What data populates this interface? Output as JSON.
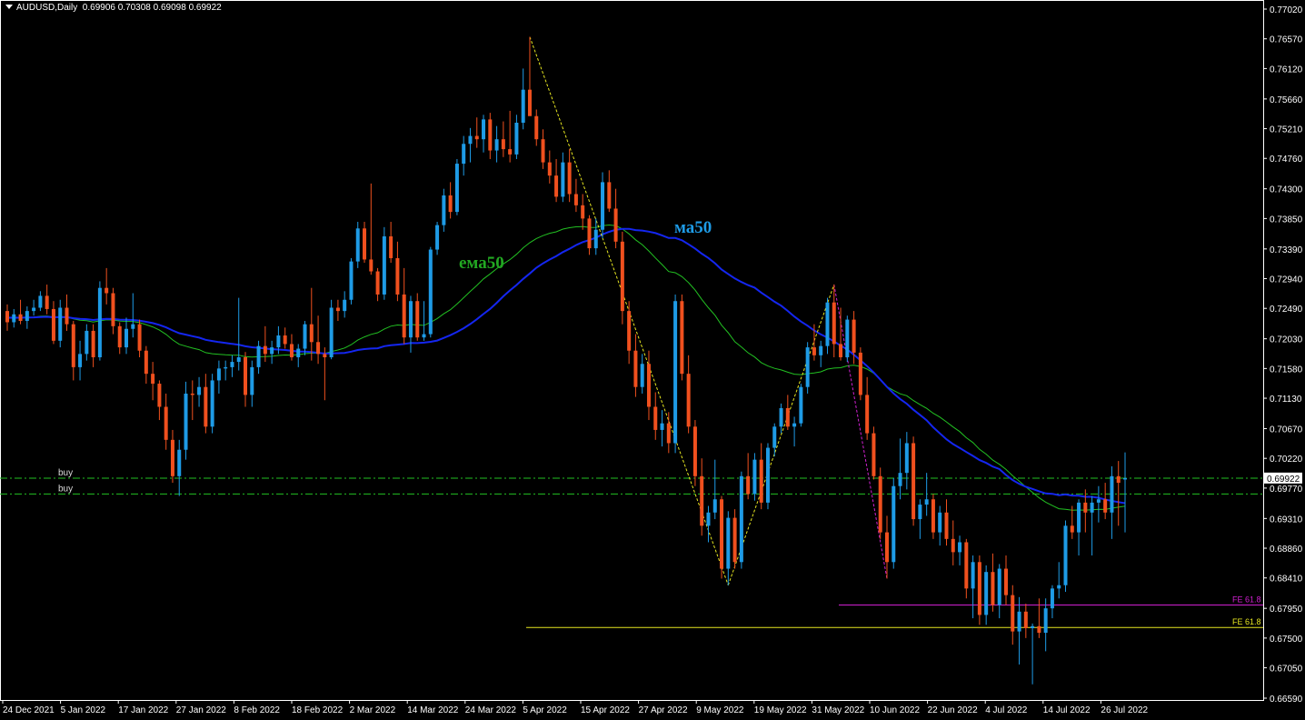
{
  "header": {
    "symbol": "AUDUSD,Daily",
    "ohlc": "0.69906 0.70308 0.69098 0.69922"
  },
  "colors": {
    "background": "#000000",
    "bull": "#1e9be6",
    "bear": "#f0501e",
    "ma50": "#1426f0",
    "ema50": "#22c022",
    "price_tag_bg": "#ffffff",
    "buy_line": "#22c022",
    "fe_magenta": "#d020d0",
    "fe_yellow": "#e6e620",
    "zigzag_yellow": "#e6e620",
    "zigzag_magenta": "#d020d0"
  },
  "chart_data": {
    "type": "candlestick",
    "ylim": [
      0.6659,
      0.7702
    ],
    "y_ticks": [
      "0.77020",
      "0.76570",
      "0.76120",
      "0.75660",
      "0.75210",
      "0.74760",
      "0.74300",
      "0.73850",
      "0.73390",
      "0.72940",
      "0.72490",
      "0.72030",
      "0.71580",
      "0.71130",
      "0.70670",
      "0.70220",
      "0.69770",
      "0.69310",
      "0.68860",
      "0.68410",
      "0.67950",
      "0.67500",
      "0.67050",
      "0.66590"
    ],
    "x_labels": [
      "24 Dec 2021",
      "5 Jan 2022",
      "17 Jan 2022",
      "27 Jan 2022",
      "8 Feb 2022",
      "18 Feb 2022",
      "2 Mar 2022",
      "14 Mar 2022",
      "24 Mar 2022",
      "5 Apr 2022",
      "15 Apr 2022",
      "27 Apr 2022",
      "9 May 2022",
      "19 May 2022",
      "31 May 2022",
      "10 Jun 2022",
      "22 Jun 2022",
      "4 Jul 2022",
      "14 Jul 2022",
      "26 Jul 2022"
    ],
    "current_price": "0.69922",
    "ohlc": [
      [
        0.7245,
        0.7255,
        0.7215,
        0.7228
      ],
      [
        0.7228,
        0.7248,
        0.722,
        0.724
      ],
      [
        0.724,
        0.7262,
        0.7225,
        0.723
      ],
      [
        0.723,
        0.7252,
        0.7218,
        0.7245
      ],
      [
        0.7245,
        0.7262,
        0.7238,
        0.725
      ],
      [
        0.725,
        0.7275,
        0.7245,
        0.7268
      ],
      [
        0.7268,
        0.7285,
        0.724,
        0.7248
      ],
      [
        0.7248,
        0.726,
        0.7195,
        0.72
      ],
      [
        0.72,
        0.7262,
        0.719,
        0.725
      ],
      [
        0.725,
        0.727,
        0.7215,
        0.7225
      ],
      [
        0.7225,
        0.723,
        0.714,
        0.716
      ],
      [
        0.716,
        0.72,
        0.714,
        0.718
      ],
      [
        0.718,
        0.7225,
        0.717,
        0.7215
      ],
      [
        0.7215,
        0.7225,
        0.716,
        0.7175
      ],
      [
        0.7175,
        0.729,
        0.717,
        0.728
      ],
      [
        0.728,
        0.731,
        0.7255,
        0.7272
      ],
      [
        0.7272,
        0.728,
        0.721,
        0.7222
      ],
      [
        0.7222,
        0.7228,
        0.718,
        0.719
      ],
      [
        0.719,
        0.7235,
        0.718,
        0.7218
      ],
      [
        0.7218,
        0.7272,
        0.7205,
        0.7225
      ],
      [
        0.7225,
        0.7232,
        0.7175,
        0.7185
      ],
      [
        0.7185,
        0.7192,
        0.7135,
        0.715
      ],
      [
        0.715,
        0.7168,
        0.711,
        0.7135
      ],
      [
        0.7135,
        0.714,
        0.708,
        0.71
      ],
      [
        0.71,
        0.712,
        0.7035,
        0.705
      ],
      [
        0.705,
        0.7065,
        0.6985,
        0.6995
      ],
      [
        0.6995,
        0.705,
        0.6965,
        0.7035
      ],
      [
        0.7035,
        0.7138,
        0.702,
        0.712
      ],
      [
        0.712,
        0.714,
        0.708,
        0.7118
      ],
      [
        0.7118,
        0.7145,
        0.71,
        0.713
      ],
      [
        0.713,
        0.715,
        0.706,
        0.707
      ],
      [
        0.707,
        0.715,
        0.706,
        0.714
      ],
      [
        0.714,
        0.717,
        0.712,
        0.7158
      ],
      [
        0.7158,
        0.717,
        0.714,
        0.716
      ],
      [
        0.716,
        0.7178,
        0.7145,
        0.7168
      ],
      [
        0.7168,
        0.7265,
        0.7155,
        0.7175
      ],
      [
        0.7175,
        0.7183,
        0.71,
        0.7118
      ],
      [
        0.7118,
        0.717,
        0.71,
        0.716
      ],
      [
        0.716,
        0.72,
        0.715,
        0.7192
      ],
      [
        0.7192,
        0.7222,
        0.7168,
        0.718
      ],
      [
        0.718,
        0.72,
        0.7165,
        0.719
      ],
      [
        0.719,
        0.7222,
        0.718,
        0.7208
      ],
      [
        0.7208,
        0.722,
        0.7188,
        0.7195
      ],
      [
        0.7195,
        0.721,
        0.717,
        0.7175
      ],
      [
        0.7175,
        0.7195,
        0.716,
        0.7188
      ],
      [
        0.7188,
        0.723,
        0.7178,
        0.7225
      ],
      [
        0.7225,
        0.728,
        0.717,
        0.7198
      ],
      [
        0.7198,
        0.7238,
        0.7165,
        0.718
      ],
      [
        0.718,
        0.719,
        0.711,
        0.7175
      ],
      [
        0.7175,
        0.7262,
        0.7172,
        0.725
      ],
      [
        0.725,
        0.7262,
        0.723,
        0.7245
      ],
      [
        0.7245,
        0.7275,
        0.7235,
        0.7262
      ],
      [
        0.7262,
        0.7325,
        0.7255,
        0.732
      ],
      [
        0.732,
        0.738,
        0.731,
        0.737
      ],
      [
        0.737,
        0.738,
        0.7318,
        0.7323
      ],
      [
        0.7323,
        0.7438,
        0.73,
        0.7305
      ],
      [
        0.7305,
        0.731,
        0.726,
        0.727
      ],
      [
        0.727,
        0.7372,
        0.7262,
        0.7358
      ],
      [
        0.7358,
        0.738,
        0.7318,
        0.7325
      ],
      [
        0.7325,
        0.735,
        0.726,
        0.727
      ],
      [
        0.727,
        0.731,
        0.7195,
        0.7205
      ],
      [
        0.7205,
        0.7268,
        0.7182,
        0.726
      ],
      [
        0.726,
        0.7272,
        0.72,
        0.7205
      ],
      [
        0.7205,
        0.726,
        0.72,
        0.721
      ],
      [
        0.721,
        0.7342,
        0.7205,
        0.7338
      ],
      [
        0.7338,
        0.738,
        0.733,
        0.7375
      ],
      [
        0.7375,
        0.743,
        0.7365,
        0.742
      ],
      [
        0.742,
        0.744,
        0.7385,
        0.7395
      ],
      [
        0.7395,
        0.7475,
        0.739,
        0.7468
      ],
      [
        0.7468,
        0.751,
        0.745,
        0.7498
      ],
      [
        0.7498,
        0.7522,
        0.747,
        0.751
      ],
      [
        0.751,
        0.7538,
        0.7492,
        0.7505
      ],
      [
        0.7505,
        0.7542,
        0.7485,
        0.7535
      ],
      [
        0.7535,
        0.7545,
        0.7475,
        0.7488
      ],
      [
        0.7488,
        0.7525,
        0.747,
        0.7505
      ],
      [
        0.7505,
        0.7532,
        0.7478,
        0.749
      ],
      [
        0.749,
        0.7548,
        0.747,
        0.7482
      ],
      [
        0.7482,
        0.7542,
        0.7475,
        0.753
      ],
      [
        0.753,
        0.7612,
        0.752,
        0.758
      ],
      [
        0.758,
        0.766,
        0.755,
        0.754
      ],
      [
        0.754,
        0.755,
        0.7495,
        0.7505
      ],
      [
        0.7505,
        0.752,
        0.746,
        0.747
      ],
      [
        0.747,
        0.7488,
        0.7438,
        0.745
      ],
      [
        0.745,
        0.7475,
        0.741,
        0.7418
      ],
      [
        0.7418,
        0.7485,
        0.741,
        0.747
      ],
      [
        0.747,
        0.749,
        0.741,
        0.7422
      ],
      [
        0.7422,
        0.7445,
        0.7395,
        0.7405
      ],
      [
        0.7405,
        0.7422,
        0.7368,
        0.7385
      ],
      [
        0.7385,
        0.739,
        0.733,
        0.734
      ],
      [
        0.734,
        0.7385,
        0.733,
        0.7368
      ],
      [
        0.7368,
        0.7455,
        0.7355,
        0.744
      ],
      [
        0.744,
        0.7458,
        0.7395,
        0.74
      ],
      [
        0.74,
        0.743,
        0.734,
        0.735
      ],
      [
        0.735,
        0.7365,
        0.7225,
        0.7245
      ],
      [
        0.7245,
        0.726,
        0.7165,
        0.7185
      ],
      [
        0.7185,
        0.721,
        0.7115,
        0.713
      ],
      [
        0.713,
        0.718,
        0.712,
        0.7165
      ],
      [
        0.7165,
        0.7185,
        0.708,
        0.71
      ],
      [
        0.71,
        0.7122,
        0.705,
        0.7065
      ],
      [
        0.7065,
        0.7095,
        0.704,
        0.7075
      ],
      [
        0.7075,
        0.7092,
        0.703,
        0.7045
      ],
      [
        0.7045,
        0.727,
        0.703,
        0.726
      ],
      [
        0.726,
        0.727,
        0.714,
        0.715
      ],
      [
        0.715,
        0.7178,
        0.706,
        0.707
      ],
      [
        0.707,
        0.708,
        0.698,
        0.6995
      ],
      [
        0.6995,
        0.7022,
        0.6905,
        0.692
      ],
      [
        0.692,
        0.695,
        0.6895,
        0.694
      ],
      [
        0.694,
        0.702,
        0.693,
        0.696
      ],
      [
        0.696,
        0.6965,
        0.684,
        0.6855
      ],
      [
        0.6855,
        0.6942,
        0.683,
        0.6932
      ],
      [
        0.6932,
        0.6945,
        0.6855,
        0.6865
      ],
      [
        0.6865,
        0.7002,
        0.6855,
        0.6995
      ],
      [
        0.6995,
        0.703,
        0.696,
        0.6968
      ],
      [
        0.6968,
        0.703,
        0.6958,
        0.702
      ],
      [
        0.702,
        0.7045,
        0.6945,
        0.6955
      ],
      [
        0.6955,
        0.7045,
        0.6945,
        0.7038
      ],
      [
        0.7038,
        0.7075,
        0.7025,
        0.707
      ],
      [
        0.707,
        0.7105,
        0.706,
        0.7098
      ],
      [
        0.7098,
        0.7118,
        0.7065,
        0.707
      ],
      [
        0.707,
        0.7085,
        0.704,
        0.7075
      ],
      [
        0.7075,
        0.7135,
        0.707,
        0.713
      ],
      [
        0.713,
        0.7198,
        0.712,
        0.719
      ],
      [
        0.719,
        0.7225,
        0.717,
        0.7178
      ],
      [
        0.7178,
        0.72,
        0.716,
        0.7192
      ],
      [
        0.7192,
        0.7265,
        0.718,
        0.7258
      ],
      [
        0.7258,
        0.7285,
        0.7175,
        0.7195
      ],
      [
        0.7195,
        0.725,
        0.717,
        0.7175
      ],
      [
        0.7175,
        0.7238,
        0.7168,
        0.7232
      ],
      [
        0.7232,
        0.7245,
        0.7165,
        0.7182
      ],
      [
        0.7182,
        0.719,
        0.711,
        0.7118
      ],
      [
        0.7118,
        0.7145,
        0.705,
        0.706
      ],
      [
        0.706,
        0.707,
        0.699,
        0.6995
      ],
      [
        0.6995,
        0.7008,
        0.69,
        0.691
      ],
      [
        0.691,
        0.6935,
        0.684,
        0.6865
      ],
      [
        0.6865,
        0.6992,
        0.6855,
        0.698
      ],
      [
        0.698,
        0.7052,
        0.696,
        0.7
      ],
      [
        0.7,
        0.7062,
        0.6975,
        0.7045
      ],
      [
        0.7045,
        0.7055,
        0.692,
        0.693
      ],
      [
        0.693,
        0.696,
        0.69,
        0.6952
      ],
      [
        0.6952,
        0.7,
        0.6935,
        0.696
      ],
      [
        0.696,
        0.6968,
        0.69,
        0.691
      ],
      [
        0.691,
        0.695,
        0.689,
        0.694
      ],
      [
        0.694,
        0.696,
        0.689,
        0.69
      ],
      [
        0.69,
        0.6928,
        0.686,
        0.688
      ],
      [
        0.688,
        0.6905,
        0.686,
        0.6895
      ],
      [
        0.6895,
        0.69,
        0.681,
        0.6825
      ],
      [
        0.6825,
        0.6875,
        0.678,
        0.6865
      ],
      [
        0.6865,
        0.6875,
        0.677,
        0.6785
      ],
      [
        0.6785,
        0.686,
        0.677,
        0.685
      ],
      [
        0.685,
        0.6878,
        0.679,
        0.68
      ],
      [
        0.68,
        0.6862,
        0.678,
        0.6855
      ],
      [
        0.6855,
        0.6875,
        0.68,
        0.6815
      ],
      [
        0.6815,
        0.683,
        0.674,
        0.676
      ],
      [
        0.676,
        0.6812,
        0.671,
        0.679
      ],
      [
        0.679,
        0.6802,
        0.675,
        0.6765
      ],
      [
        0.6765,
        0.6772,
        0.668,
        0.6768
      ],
      [
        0.6768,
        0.681,
        0.675,
        0.6758
      ],
      [
        0.6758,
        0.681,
        0.673,
        0.6795
      ],
      [
        0.6795,
        0.683,
        0.678,
        0.6825
      ],
      [
        0.6825,
        0.6865,
        0.681,
        0.683
      ],
      [
        0.683,
        0.6928,
        0.682,
        0.692
      ],
      [
        0.692,
        0.695,
        0.69,
        0.691
      ],
      [
        0.691,
        0.696,
        0.6875,
        0.6955
      ],
      [
        0.6955,
        0.6975,
        0.691,
        0.694
      ],
      [
        0.694,
        0.6965,
        0.6875,
        0.6955
      ],
      [
        0.6955,
        0.698,
        0.6925,
        0.696
      ],
      [
        0.696,
        0.6985,
        0.693,
        0.694
      ],
      [
        0.694,
        0.701,
        0.69,
        0.6995
      ],
      [
        0.6995,
        0.7018,
        0.692,
        0.6985
      ],
      [
        0.699,
        0.7031,
        0.691,
        0.6992
      ]
    ],
    "ma50_label": "ма50",
    "ema50_label": "ема50",
    "horizontal_lines": [
      {
        "label": "buy",
        "price": 0.6992
      },
      {
        "label": "buy",
        "price": 0.6968
      }
    ],
    "fe_levels": [
      {
        "label": "FE 61.8",
        "price": 0.68,
        "color": "#d020d0"
      },
      {
        "label": "FE 61.8",
        "price": 0.6766,
        "color": "#e6e620"
      }
    ]
  }
}
